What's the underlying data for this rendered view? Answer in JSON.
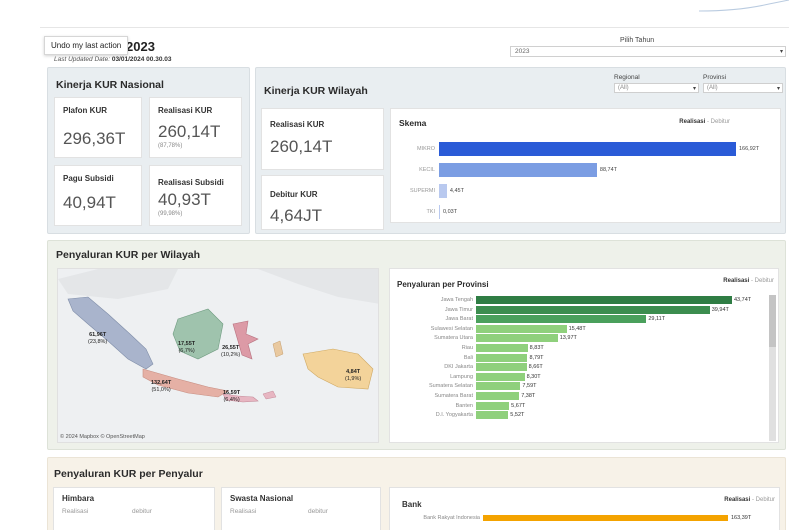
{
  "header": {
    "undo_tooltip": "Undo my last action",
    "title": "R 2023",
    "updated_label": "Last Updated Date:",
    "updated_value": "03/01/2024 00.30.03",
    "year_filter_label": "Pilih Tahun",
    "year_filter_value": "2023"
  },
  "nasional": {
    "title": "Kinerja KUR Nasional",
    "cards": [
      {
        "label": "Plafon KUR",
        "value": "296,36T",
        "sub": ""
      },
      {
        "label": "Realisasi KUR",
        "value": "260,14T",
        "sub": "(87,78%)"
      },
      {
        "label": "Pagu Subsidi",
        "value": "40,94T",
        "sub": ""
      },
      {
        "label": "Realisasi Subsidi",
        "value": "40,93T",
        "sub": "(99,98%)"
      }
    ]
  },
  "wilayah": {
    "title": "Kinerja KUR Wilayah",
    "filter_regional_label": "Regional",
    "filter_regional_value": "(All)",
    "filter_provinsi_label": "Provinsi",
    "filter_provinsi_value": "(All)",
    "realisasi_label": "Realisasi KUR",
    "realisasi_value": "260,14T",
    "debitur_label": "Debitur KUR",
    "debitur_value": "4,64JT",
    "skema_title": "Skema",
    "legend_realisasi": "Realisasi",
    "legend_sep": " - ",
    "legend_debitur": "Debitur"
  },
  "provinsi_panel": {
    "title": "Penyaluran KUR per Wilayah",
    "map_credit": "© 2024 Mapbox © OpenStreetMap",
    "map_labels": [
      {
        "value": "61,96T",
        "pct": "(23,8%)"
      },
      {
        "value": "17,55T",
        "pct": "(6,7%)"
      },
      {
        "value": "26,55T",
        "pct": "(10,2%)"
      },
      {
        "value": "4,84T",
        "pct": "(1,9%)"
      },
      {
        "value": "132,64T",
        "pct": "(51,0%)"
      },
      {
        "value": "16,59T",
        "pct": "(6,4%)"
      }
    ],
    "chart_title": "Penyaluran per Provinsi",
    "legend_realisasi": "Realisasi",
    "legend_sep": " - ",
    "legend_debitur": "Debitur"
  },
  "penyalur": {
    "title": "Penyaluran KUR per Penyalur",
    "himbara": "Himbara",
    "swasta": "Swasta Nasional",
    "bank": "Bank",
    "col_realisasi": "Realisasi",
    "col_debitur": "debitur",
    "legend_realisasi": "Realisasi",
    "legend_sep": " - ",
    "legend_debitur": "Debitur",
    "bank_row_label": "Bank Rakyat Indonesia",
    "bank_row_value": "163,39T"
  },
  "chart_data": [
    {
      "type": "bar",
      "title": "Skema",
      "categories": [
        "MIKRO",
        "KECIL",
        "SUPERMI",
        "TKI"
      ],
      "values": [
        166.92,
        88.74,
        4.45,
        0.03
      ],
      "labels": [
        "166,92T",
        "88,74T",
        "4,45T",
        "0,03T"
      ],
      "colors": [
        "#2a5bd7",
        "#7b9de3",
        "#b9c9ef",
        "#b9c9ef"
      ]
    },
    {
      "type": "bar",
      "title": "Penyaluran per Provinsi",
      "categories": [
        "Jawa Tengah",
        "Jawa Timur",
        "Jawa Barat",
        "Sulawesi Selatan",
        "Sumatera Utara",
        "Riau",
        "Bali",
        "DKI Jakarta",
        "Lampung",
        "Sumatera Selatan",
        "Sumatera Barat",
        "Banten",
        "D.I. Yogyakarta"
      ],
      "values": [
        43.74,
        39.94,
        29.11,
        15.48,
        13.97,
        8.83,
        8.79,
        8.66,
        8.3,
        7.59,
        7.38,
        5.67,
        5.52
      ],
      "labels": [
        "43,74T",
        "39,94T",
        "29,11T",
        "15,48T",
        "13,97T",
        "8,83T",
        "8,79T",
        "8,66T",
        "8,30T",
        "7,59T",
        "7,38T",
        "5,67T",
        "5,52T"
      ]
    }
  ]
}
